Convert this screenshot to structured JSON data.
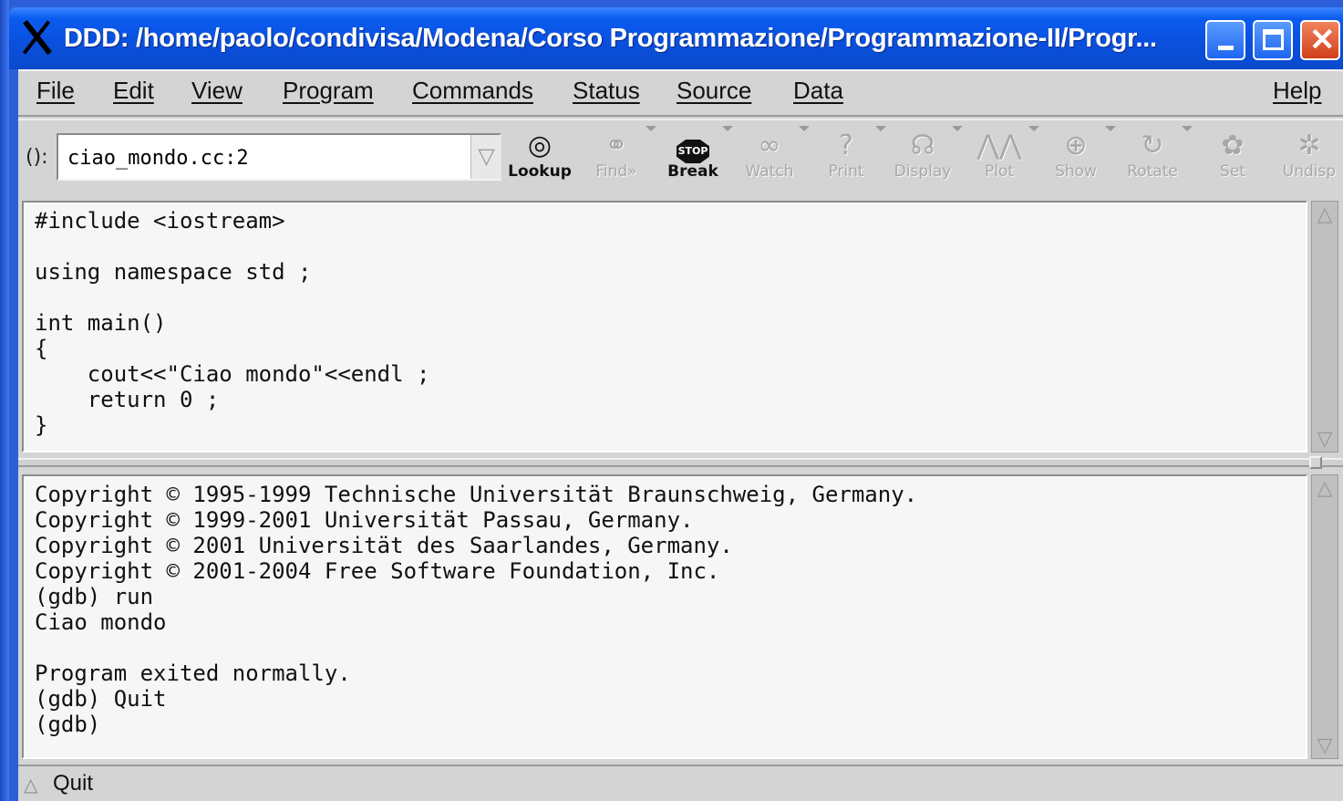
{
  "window": {
    "title": "DDD: /home/paolo/condivisa/Modena/Corso Programmazione/Programmazione-II/Progr..."
  },
  "menu": [
    {
      "label": "File"
    },
    {
      "label": "Edit"
    },
    {
      "label": "View"
    },
    {
      "label": "Program"
    },
    {
      "label": "Commands"
    },
    {
      "label": "Status"
    },
    {
      "label": "Source"
    },
    {
      "label": "Data"
    },
    {
      "label": "Help"
    }
  ],
  "toolbar": {
    "arg_label": "():",
    "arg_value": "ciao_mondo.cc:2",
    "tools": [
      {
        "label": "Lookup",
        "icon": "lookup-icon",
        "enabled": true
      },
      {
        "label": "Find»",
        "icon": "binoculars-icon",
        "enabled": false
      },
      {
        "label": "Break",
        "icon": "stop-sign-icon",
        "enabled": true
      },
      {
        "label": "Watch",
        "icon": "glasses-icon",
        "enabled": false
      },
      {
        "label": "Print",
        "icon": "question-icon",
        "enabled": false
      },
      {
        "label": "Display",
        "icon": "display-icon",
        "enabled": false
      },
      {
        "label": "Plot",
        "icon": "plot-icon",
        "enabled": false
      },
      {
        "label": "Show",
        "icon": "magnifier-icon",
        "enabled": false
      },
      {
        "label": "Rotate",
        "icon": "rotate-icon",
        "enabled": false
      },
      {
        "label": "Set",
        "icon": "set-icon",
        "enabled": false
      },
      {
        "label": "Undisp",
        "icon": "undisplay-icon",
        "enabled": false
      }
    ]
  },
  "source": {
    "lines": [
      "#include <iostream>",
      "",
      "using namespace std ;",
      "",
      "int main()",
      "{",
      "    cout<<\"Ciao mondo\"<<endl ;",
      "    return 0 ;",
      "}"
    ]
  },
  "console": {
    "lines": [
      "Copyright © 1995-1999 Technische Universität Braunschweig, Germany.",
      "Copyright © 1999-2001 Universität Passau, Germany.",
      "Copyright © 2001 Universität des Saarlandes, Germany.",
      "Copyright © 2001-2004 Free Software Foundation, Inc.",
      "(gdb) run",
      "Ciao mondo",
      "",
      "Program exited normally.",
      "(gdb) Quit",
      "(gdb)"
    ]
  },
  "status": {
    "text": "Quit"
  }
}
